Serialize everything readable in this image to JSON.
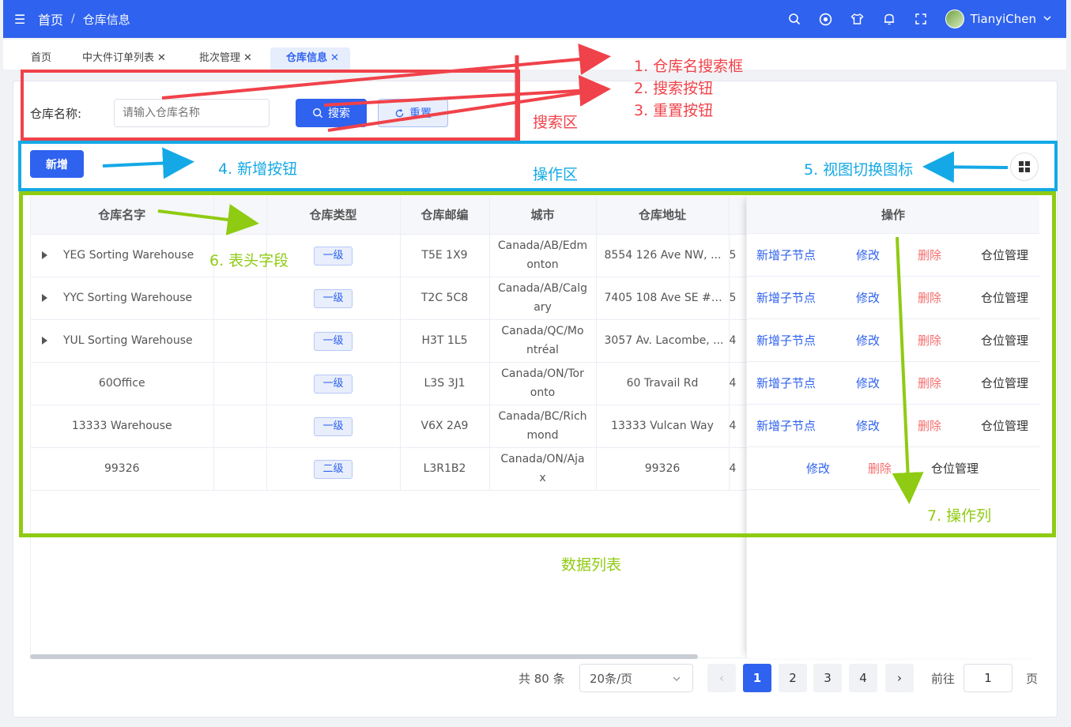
{
  "topbar": {
    "breadcrumb_home": "首页",
    "breadcrumb_sep": "/",
    "breadcrumb_current": "仓库信息",
    "username": "TianyiChen",
    "icons": [
      "search-icon",
      "github-icon",
      "theme-shirt-icon",
      "bell-icon",
      "fullscreen-icon"
    ]
  },
  "tabs": [
    {
      "label": "首页",
      "closable": false
    },
    {
      "label": "中大件订单列表",
      "closable": true
    },
    {
      "label": "批次管理",
      "closable": true
    },
    {
      "label": "仓库信息",
      "closable": true,
      "active": true
    }
  ],
  "search": {
    "label": "仓库名称:",
    "placeholder": "请输入仓库名称",
    "search_button": "搜索",
    "reset_button": "重置"
  },
  "toolbar": {
    "add_button": "新增"
  },
  "table": {
    "columns": [
      "仓库名字",
      "",
      "仓库类型",
      "仓库邮编",
      "城市",
      "仓库地址",
      "",
      "操作"
    ],
    "rows": [
      {
        "name": "YEG Sorting Warehouse",
        "expandable": true,
        "type": "一级",
        "postcode": "T5E 1X9",
        "city_l1": "Canada/AB/Edm",
        "city_l2": "onton",
        "address": "8554 126 Ave NW, ...",
        "extra": "5",
        "ops": [
          "新增子节点",
          "修改",
          "删除",
          "仓位管理"
        ]
      },
      {
        "name": "YYC Sorting Warehouse",
        "expandable": true,
        "type": "一级",
        "postcode": "T2C 5C8",
        "city_l1": "Canada/AB/Calg",
        "city_l2": "ary",
        "address": "7405 108 Ave SE #1...",
        "extra": "5",
        "ops": [
          "新增子节点",
          "修改",
          "删除",
          "仓位管理"
        ]
      },
      {
        "name": "YUL Sorting Warehouse",
        "expandable": true,
        "type": "一级",
        "postcode": "H3T 1L5",
        "city_l1": "Canada/QC/Mo",
        "city_l2": "ntréal",
        "address": "3057 Av. Lacombe, ...",
        "extra": "4",
        "ops": [
          "新增子节点",
          "修改",
          "删除",
          "仓位管理"
        ]
      },
      {
        "name": "60Office",
        "expandable": false,
        "type": "一级",
        "postcode": "L3S 3J1",
        "city_l1": "Canada/ON/Tor",
        "city_l2": "onto",
        "address": "60 Travail Rd",
        "extra": "4",
        "ops": [
          "新增子节点",
          "修改",
          "删除",
          "仓位管理"
        ]
      },
      {
        "name": "13333 Warehouse",
        "expandable": false,
        "type": "一级",
        "postcode": "V6X 2A9",
        "city_l1": "Canada/BC/Rich",
        "city_l2": "mond",
        "address": "13333 Vulcan Way",
        "extra": "4",
        "ops": [
          "新增子节点",
          "修改",
          "删除",
          "仓位管理"
        ]
      },
      {
        "name": "99326",
        "expandable": false,
        "type": "二级",
        "postcode": "L3R1B2",
        "city_l1": "Canada/ON/Aja",
        "city_l2": "x",
        "address": "99326",
        "extra": "4",
        "ops": [
          "修改",
          "删除",
          "仓位管理"
        ]
      }
    ]
  },
  "pagination": {
    "total": "共 80 条",
    "page_size": "20条/页",
    "pages": [
      "1",
      "2",
      "3",
      "4"
    ],
    "current": "1",
    "goto_label": "前往",
    "goto_value": "1",
    "page_unit": "页"
  },
  "annotations": {
    "a1": "1. 仓库名搜索框",
    "a2": "2. 搜索按钮",
    "a3": "3. 重置按钮",
    "search_area": "搜索区",
    "a4": "4. 新增按钮",
    "op_area": "操作区",
    "a5": "5. 视图切换图标",
    "a6": "6. 表头字段",
    "a7": "7. 操作列",
    "data_list": "数据列表",
    "colors": {
      "search": "#f0424a",
      "operation": "#14a9e6",
      "data": "#8fcb12"
    }
  },
  "colors": {
    "primary": "#2f62ee",
    "danger": "#f56c6c"
  }
}
